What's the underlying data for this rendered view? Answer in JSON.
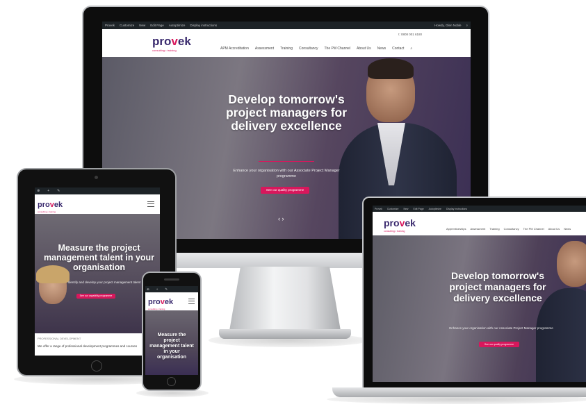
{
  "brand": {
    "logo_main": "pro",
    "logo_accent": "v",
    "logo_end": "ek",
    "tagline": "consulting • training"
  },
  "imac": {
    "adminbar": {
      "items": [
        "Provek",
        "Customize",
        "New",
        "Edit Page",
        "Autoptimize",
        "Display instructions"
      ],
      "right": "Howdy, Glen Noble"
    },
    "phone": "t: 0808 001 6180",
    "nav": [
      "APM Accreditation",
      "Assessment",
      "Training",
      "Consultancy",
      "The PM Channel",
      "About Us",
      "News",
      "Contact"
    ],
    "hero_title": "Develop tomorrow's project managers for delivery excellence",
    "hero_text": "Enhance your organisation with our Associate Project Manager programme",
    "cta": "See our quality programme",
    "arrows": "‹ ›"
  },
  "laptop": {
    "adminbar": {
      "items": [
        "Provek",
        "Customize",
        "New",
        "Edit Page",
        "Autoptimize",
        "Display instructions"
      ]
    },
    "nav": [
      "Apprenticeships",
      "Assessment",
      "Training",
      "Consultancy",
      "The PM Channel",
      "About Us",
      "News"
    ],
    "hero_title": "Develop tomorrow's project managers for delivery excellence",
    "hero_text": "Enhance your organisation with our Associate Project Manager programme",
    "cta": "See our quality programme"
  },
  "tablet": {
    "hero_title": "Measure the project management talent in your organisation",
    "hero_text": "Identify and develop your project management talent",
    "cta": "See our capability programme",
    "section_label": "PROFESSIONAL DEVELOPMENT",
    "section_text": "We offer a range of professional development programmes and courses"
  },
  "phone": {
    "hero_title": "Measure the project management talent in your organisation"
  },
  "colors": {
    "brand_purple": "#3a2a6e",
    "brand_pink": "#d8175c",
    "hero_overlay": "#3b2f54",
    "device_black": "#0d0d0d",
    "adminbar": "#1d2327"
  }
}
